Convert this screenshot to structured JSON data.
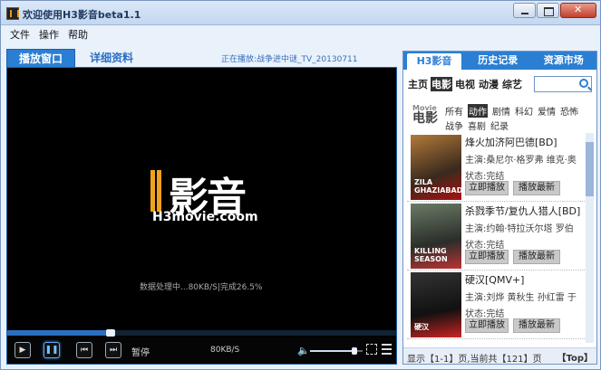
{
  "window": {
    "title": "欢迎使用H3影音beta1.1"
  },
  "menu": [
    "文件",
    "操作",
    "帮助"
  ],
  "tabs": {
    "player": "播放窗口",
    "detail": "详细资料"
  },
  "now_playing": "正在播放:战争进中谜_TV_20130711",
  "player": {
    "logo_cn": "影音",
    "logo_en": "H3movie.coom",
    "status": "数据处理中...80KB/S|完成26.5%",
    "progress": 0.265,
    "pause_label": "暂停",
    "speed": "80KB/S",
    "volume": 0.85
  },
  "panel": {
    "tabs": [
      "H3影音",
      "历史记录",
      "资源市场"
    ],
    "categories": [
      "主页",
      "电影",
      "电视",
      "动漫",
      "综艺"
    ],
    "active_category": "电影",
    "movie_badge": {
      "en": "Movie",
      "cn": "电影"
    },
    "genres": [
      "所有",
      "动作",
      "剧情",
      "科幻",
      "爱情",
      "恐怖",
      "战争",
      "喜剧",
      "纪录"
    ],
    "active_genre": "动作",
    "items": [
      {
        "title": "烽火加济阿巴德[BD]",
        "cast": "主演:桑尼尔·格罗弗 维克·奥",
        "status": "状态:完结",
        "poster_text": "ZILA GHAZIABAD",
        "play": "立即播放",
        "update": "播放最新"
      },
      {
        "title": "杀戮季节/复仇人猎人[BD]",
        "cast": "主演:约翰·特拉沃尔塔 罗伯",
        "status": "状态:完结",
        "poster_text": "KILLING SEASON",
        "play": "立即播放",
        "update": "播放最新"
      },
      {
        "title": "硬汉[QMV+]",
        "cast": "主演:刘烨 黄秋生 孙红雷 于",
        "status": "状态:完结",
        "poster_text": "硬汉",
        "play": "立即播放",
        "update": "播放最新"
      }
    ],
    "footer": "显示【1-1】页,当前共【121】页",
    "top": "【Top】"
  }
}
